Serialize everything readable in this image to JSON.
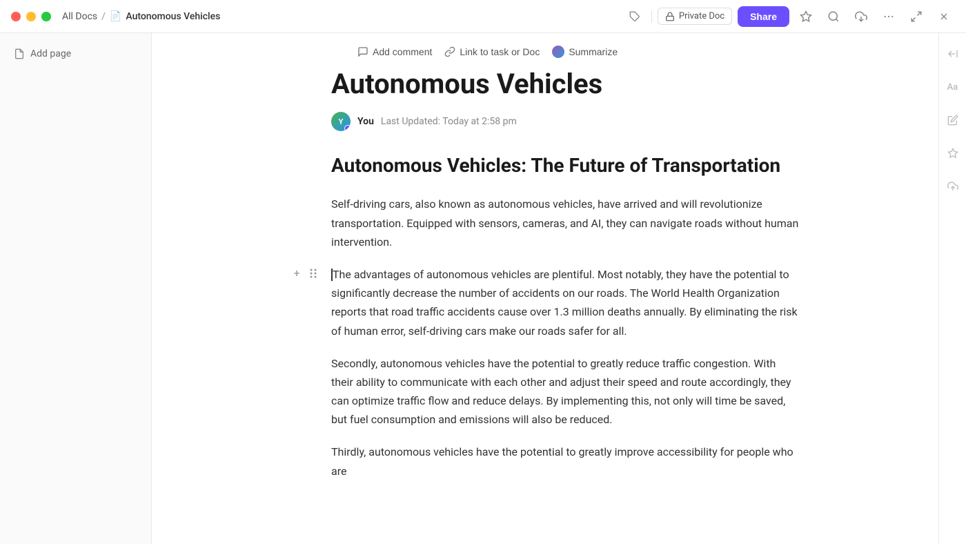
{
  "titleBar": {
    "breadcrumb": {
      "allDocs": "All Docs",
      "separator": "/",
      "current": "Autonomous Vehicles"
    },
    "privateBadge": "Private Doc",
    "shareLabel": "Share"
  },
  "sidebar": {
    "addPageLabel": "Add page"
  },
  "toolbar": {
    "addCommentLabel": "Add comment",
    "linkLabel": "Link to task or Doc",
    "summarizeLabel": "Summarize"
  },
  "document": {
    "title": "Autonomous Vehicles",
    "author": "You",
    "lastUpdated": "Last Updated: Today at 2:58 pm",
    "sectionTitle": "Autonomous Vehicles: The Future of Transportation",
    "paragraphs": [
      "Self-driving cars, also known as autonomous vehicles, have arrived and will revolutionize transportation. Equipped with sensors, cameras, and AI, they can navigate roads without human intervention.",
      "The advantages of autonomous vehicles are plentiful. Most notably, they have the potential to significantly decrease the number of accidents on our roads. The World Health Organization reports that road traffic accidents cause over 1.3 million deaths annually. By eliminating the risk of human error, self-driving cars make our roads safer for all.",
      "Secondly, autonomous vehicles have the potential to greatly reduce traffic congestion. With their ability to communicate with each other and adjust their speed and route accordingly, they can optimize traffic flow and reduce delays. By implementing this, not only will time be saved, but fuel consumption and emissions will also be reduced.",
      "Thirdly, autonomous vehicles have the potential to greatly improve accessibility for people who are"
    ]
  },
  "icons": {
    "tag": "🏷",
    "lock": "🔒",
    "star": "☆",
    "search": "🔍",
    "download": "⬇",
    "more": "•••",
    "expand": "⤢",
    "close": "✕",
    "comment": "💬",
    "link": "↗",
    "addPage": "📄",
    "collapse": "⇤",
    "textSize": "Aa",
    "pen": "✏",
    "sparkle": "✦",
    "share": "⬆"
  }
}
